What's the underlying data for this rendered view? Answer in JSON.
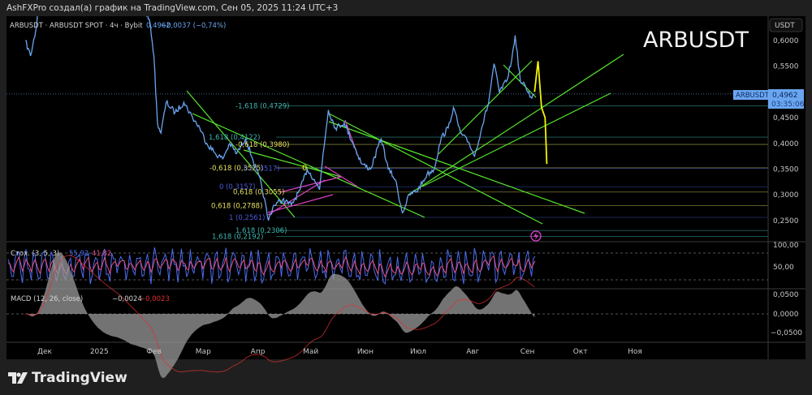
{
  "attribution": "AshFXPro создал(а) график на TradingView.com, Сен 05, 2025 11:24 UTC+3",
  "legend": {
    "symbol": "ARBUSDT · ARBUSDT SPOT · 4ч · Bybit",
    "last": "0,4962",
    "change": "−0,0037 (−0,74%)"
  },
  "watermark": "ARBUSDT",
  "currency_label": "USDT",
  "price_tag": {
    "symbol": "ARBUSDT",
    "price": "0,4962",
    "countdown": "03:35:06"
  },
  "stoch": {
    "label": "Стох. (3, 5, 3)",
    "k": "55,92",
    "d": "41,82",
    "axis": [
      "100,00",
      "50,00"
    ]
  },
  "macd": {
    "label": "MACD (12, 26, close)",
    "macd": "−0,0024",
    "signal": "−0,0023",
    "axis": [
      "0,0500",
      "0,0000",
      "−0,0500"
    ]
  },
  "brand": "TradingView",
  "colors": {
    "price": "#6aa6f0",
    "projection": "#f5f500",
    "trend": "#57e62b",
    "fib_magenta": "#e040c8",
    "stoch_k": "#4a6cf0",
    "stoch_d": "#e0508a",
    "macd_hist": "#9a9a9a",
    "tag": "#6aa6f0"
  },
  "chart_data": {
    "type": "line",
    "title": "ARBUSDT",
    "ylabel": "USDT",
    "ylim": [
      0.21,
      0.63
    ],
    "y_ticks": [
      "0,6000",
      "0,5500",
      "0,4500",
      "0,4000",
      "0,3500",
      "0,3000",
      "0,2500"
    ],
    "x_ticks": [
      {
        "label": "Дек",
        "date": "2024-12-01"
      },
      {
        "label": "2025",
        "date": "2025-01-01"
      },
      {
        "label": "Фев",
        "date": "2025-02-01"
      },
      {
        "label": "Мар",
        "date": "2025-03-01"
      },
      {
        "label": "Апр",
        "date": "2025-04-01"
      },
      {
        "label": "Май",
        "date": "2025-05-01"
      },
      {
        "label": "Июн",
        "date": "2025-06-01"
      },
      {
        "label": "Июл",
        "date": "2025-07-01"
      },
      {
        "label": "Авг",
        "date": "2025-08-01"
      },
      {
        "label": "Сен",
        "date": "2025-09-01"
      },
      {
        "label": "Окт",
        "date": "2025-10-01"
      },
      {
        "label": "Ноя",
        "date": "2025-11-01"
      }
    ],
    "series": [
      {
        "points": [
          [
            "2024-11-20",
            0.6
          ],
          [
            "2024-11-23",
            0.57
          ],
          [
            "2024-11-26",
            0.62
          ],
          [
            "2024-11-30",
            0.75
          ],
          [
            "2024-12-06",
            0.95
          ],
          [
            "2024-12-20",
            0.82
          ],
          [
            "2025-01-10",
            0.78
          ],
          [
            "2025-01-25",
            0.68
          ],
          [
            "2025-01-30",
            0.63
          ],
          [
            "2025-02-01",
            0.57
          ],
          [
            "2025-02-03",
            0.44
          ],
          [
            "2025-02-05",
            0.42
          ],
          [
            "2025-02-08",
            0.48
          ],
          [
            "2025-02-13",
            0.46
          ],
          [
            "2025-02-18",
            0.48
          ],
          [
            "2025-02-23",
            0.45
          ],
          [
            "2025-02-27",
            0.43
          ],
          [
            "2025-03-03",
            0.4
          ],
          [
            "2025-03-08",
            0.38
          ],
          [
            "2025-03-12",
            0.37
          ],
          [
            "2025-03-16",
            0.4
          ],
          [
            "2025-03-20",
            0.38
          ],
          [
            "2025-03-25",
            0.41
          ],
          [
            "2025-03-29",
            0.37
          ],
          [
            "2025-04-03",
            0.32
          ],
          [
            "2025-04-07",
            0.25
          ],
          [
            "2025-04-10",
            0.28
          ],
          [
            "2025-04-15",
            0.29
          ],
          [
            "2025-04-20",
            0.28
          ],
          [
            "2025-04-25",
            0.31
          ],
          [
            "2025-04-29",
            0.35
          ],
          [
            "2025-05-03",
            0.33
          ],
          [
            "2025-05-06",
            0.31
          ],
          [
            "2025-05-08",
            0.38
          ],
          [
            "2025-05-11",
            0.465
          ],
          [
            "2025-05-15",
            0.43
          ],
          [
            "2025-05-20",
            0.44
          ],
          [
            "2025-05-25",
            0.4
          ],
          [
            "2025-05-30",
            0.36
          ],
          [
            "2025-06-04",
            0.35
          ],
          [
            "2025-06-10",
            0.41
          ],
          [
            "2025-06-14",
            0.35
          ],
          [
            "2025-06-18",
            0.33
          ],
          [
            "2025-06-22",
            0.265
          ],
          [
            "2025-06-26",
            0.3
          ],
          [
            "2025-07-01",
            0.31
          ],
          [
            "2025-07-06",
            0.34
          ],
          [
            "2025-07-10",
            0.35
          ],
          [
            "2025-07-14",
            0.41
          ],
          [
            "2025-07-18",
            0.43
          ],
          [
            "2025-07-21",
            0.47
          ],
          [
            "2025-07-25",
            0.42
          ],
          [
            "2025-07-30",
            0.4
          ],
          [
            "2025-08-02",
            0.375
          ],
          [
            "2025-08-06",
            0.43
          ],
          [
            "2025-08-10",
            0.48
          ],
          [
            "2025-08-13",
            0.555
          ],
          [
            "2025-08-16",
            0.5
          ],
          [
            "2025-08-20",
            0.52
          ],
          [
            "2025-08-23",
            0.56
          ],
          [
            "2025-08-25",
            0.61
          ],
          [
            "2025-08-28",
            0.52
          ],
          [
            "2025-08-31",
            0.51
          ],
          [
            "2025-09-03",
            0.49
          ],
          [
            "2025-09-05",
            0.4962
          ]
        ]
      },
      {
        "points": [
          [
            "2025-09-05",
            0.5
          ],
          [
            "2025-09-07",
            0.56
          ],
          [
            "2025-09-09",
            0.47
          ],
          [
            "2025-09-11",
            0.45
          ],
          [
            "2025-09-12",
            0.36
          ]
        ]
      }
    ],
    "fib_levels": [
      {
        "label": "-1,618 (0,4729)",
        "price": 0.4729,
        "color": "#3fb6b0"
      },
      {
        "label": "1,618 (0,4122)",
        "price": 0.4122,
        "color": "#3fb6b0"
      },
      {
        "label": "-0,618 (0,3980)",
        "price": 0.398,
        "color": "#e6e060"
      },
      {
        "label": "-0,618 (0,3525)",
        "price": 0.3525,
        "color": "#e6e060"
      },
      {
        "label": "0 (0,3517)",
        "price": 0.3517,
        "color": "#4a5ad8"
      },
      {
        "label": "0 (0,3157)",
        "price": 0.3157,
        "color": "#4a5ad8"
      },
      {
        "label": "0,618 (0,3055)",
        "price": 0.3055,
        "color": "#e6e060"
      },
      {
        "label": "0,618 (0,2788)",
        "price": 0.2788,
        "color": "#e6e060"
      },
      {
        "label": "1 (0,2561)",
        "price": 0.2561,
        "color": "#4a5ad8"
      },
      {
        "label": "1,618 (0,2306)",
        "price": 0.2306,
        "color": "#3fb6b0"
      },
      {
        "label": "1,618 (0,2192)",
        "price": 0.2192,
        "color": "#3fb6b0"
      }
    ],
    "annotation": "0"
  }
}
